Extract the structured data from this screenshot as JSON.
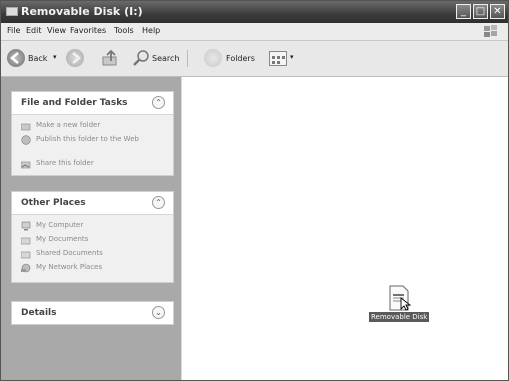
{
  "window": {
    "title": "Removable Disk (I:)"
  },
  "menu": [
    "File",
    "Edit",
    "View",
    "Favorites",
    "Tools",
    "Help"
  ],
  "toolbar": {
    "back_label": "Back",
    "search_label": "Search",
    "folders_label": "Folders"
  },
  "tasks_panel": {
    "title": "File and Folder Tasks",
    "items": [
      "Make a new folder",
      "Publish this folder to the Web",
      "Share this folder"
    ]
  },
  "places_panel": {
    "title": "Other Places",
    "items": [
      "My Computer",
      "My Documents",
      "Shared Documents",
      "My Network Places"
    ]
  },
  "details_panel": {
    "title": "Details"
  },
  "content": {
    "file_label": "Removable Disk"
  },
  "icons": {
    "window": "window-icon",
    "back": "back-arrow-icon",
    "forward": "forward-arrow-icon",
    "up": "up-folder-icon",
    "search": "search-icon",
    "folders": "folders-icon",
    "views": "views-icon",
    "logo": "windows-flag-icon"
  }
}
